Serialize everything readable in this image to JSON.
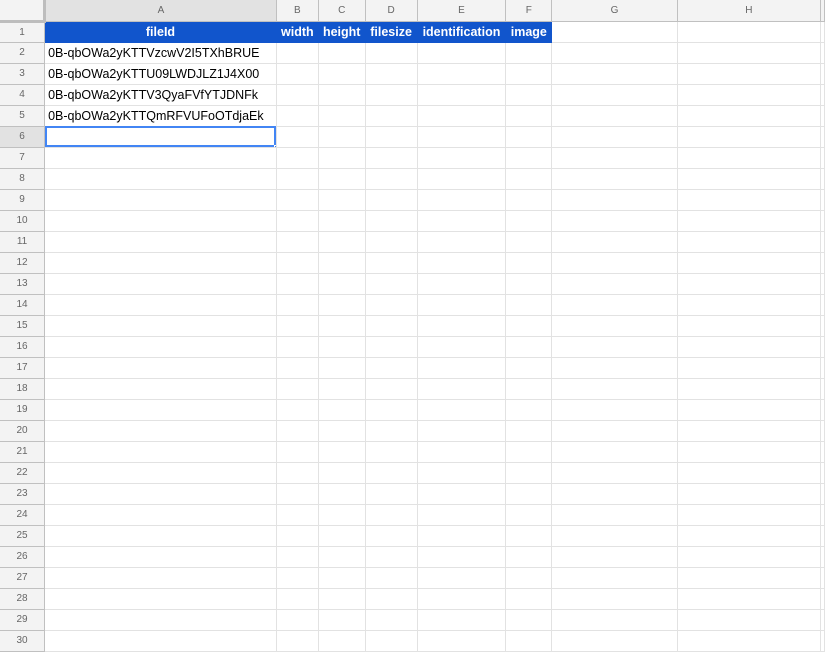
{
  "columns": [
    "A",
    "B",
    "C",
    "D",
    "E",
    "F",
    "G",
    "H"
  ],
  "header_row": [
    "fileId",
    "width",
    "height",
    "filesize",
    "identification",
    "image"
  ],
  "data_rows": [
    [
      "0B-qbOWa2yKTTVzcwV2I5TXhBRUE"
    ],
    [
      "0B-qbOWa2yKTTU09LWDJLZ1J4X00"
    ],
    [
      "0B-qbOWa2yKTTV3QyaFVfYTJDNFk"
    ],
    [
      "0B-qbOWa2yKTTQmRFVUFoOTdjaEk"
    ]
  ],
  "row_numbers": [
    "1",
    "2",
    "3",
    "4",
    "5",
    "6",
    "7",
    "8",
    "9",
    "10",
    "11",
    "12",
    "13",
    "14",
    "15",
    "16",
    "17",
    "18",
    "19",
    "20",
    "21",
    "22",
    "23",
    "24",
    "25",
    "26",
    "27",
    "28",
    "29",
    "30"
  ],
  "selected_cell": "A6",
  "colors": {
    "header_fill": "#1155cc",
    "header_text": "#ffffff",
    "selection": "#4285f4"
  }
}
